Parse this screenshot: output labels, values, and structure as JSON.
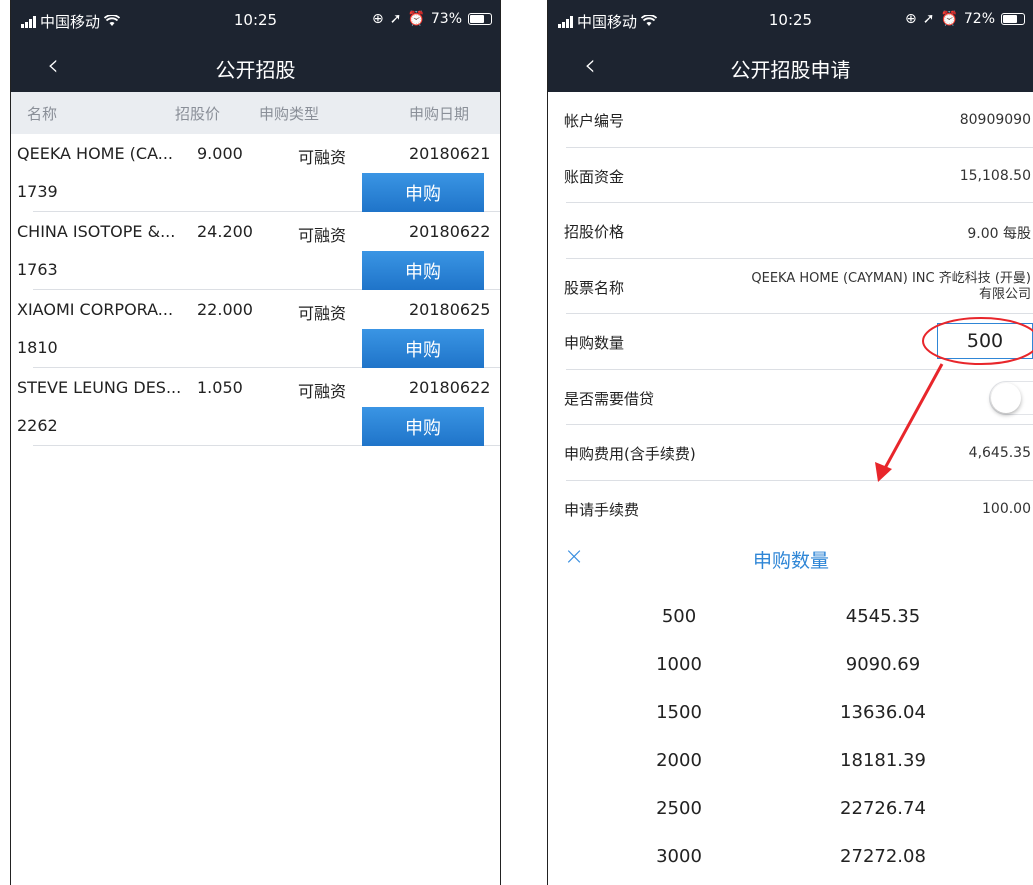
{
  "left": {
    "status": {
      "carrier": "中国移动",
      "time": "10:25",
      "battery": "73%",
      "battery_level": 0.73
    },
    "nav": {
      "back": "‹",
      "title": "公开招股"
    },
    "columns": [
      "名称",
      "招股价",
      "申购类型",
      "申购日期"
    ],
    "rows": [
      {
        "name": "QEEKA HOME (CA...",
        "code": "1739",
        "price": "9.000",
        "type": "可融资",
        "date": "20180621",
        "button": "申购"
      },
      {
        "name": "CHINA ISOTOPE &...",
        "code": "1763",
        "price": "24.200",
        "type": "可融资",
        "date": "20180622",
        "button": "申购"
      },
      {
        "name": "XIAOMI CORPORA...",
        "code": "1810",
        "price": "22.000",
        "type": "可融资",
        "date": "20180625",
        "button": "申购"
      },
      {
        "name": "STEVE LEUNG DES...",
        "code": "2262",
        "price": "1.050",
        "type": "可融资",
        "date": "20180622",
        "button": "申购"
      }
    ]
  },
  "right": {
    "status": {
      "carrier": "中国移动",
      "time": "10:25",
      "battery": "72%",
      "battery_level": 0.72
    },
    "nav": {
      "back": "‹",
      "title": "公开招股申请"
    },
    "form": {
      "account_label": "帐户编号",
      "account_value": "80909090",
      "funds_label": "账面资金",
      "funds_value": "15,108.50",
      "price_label": "招股价格",
      "price_value": "9.00 每股",
      "stock_label": "股票名称",
      "stock_value_1": "QEEKA HOME (CAYMAN) INC 齐屹科技 (开曼)",
      "stock_value_2": "有限公司",
      "qty_label": "申购数量",
      "qty_value": "500",
      "loan_label": "是否需要借贷",
      "loan_on": false,
      "fee_label": "申购费用(含手续费)",
      "fee_value": "4,645.35",
      "handling_label": "申请手续费",
      "handling_value": "100.00"
    },
    "sheet": {
      "close": "×",
      "title": "申购数量",
      "options": [
        {
          "qty": "500",
          "amount": "4545.35"
        },
        {
          "qty": "1000",
          "amount": "9090.69"
        },
        {
          "qty": "1500",
          "amount": "13636.04"
        },
        {
          "qty": "2000",
          "amount": "18181.39"
        },
        {
          "qty": "2500",
          "amount": "22726.74"
        },
        {
          "qty": "3000",
          "amount": "27272.08"
        }
      ]
    },
    "annotation_color": "#e8262b"
  }
}
